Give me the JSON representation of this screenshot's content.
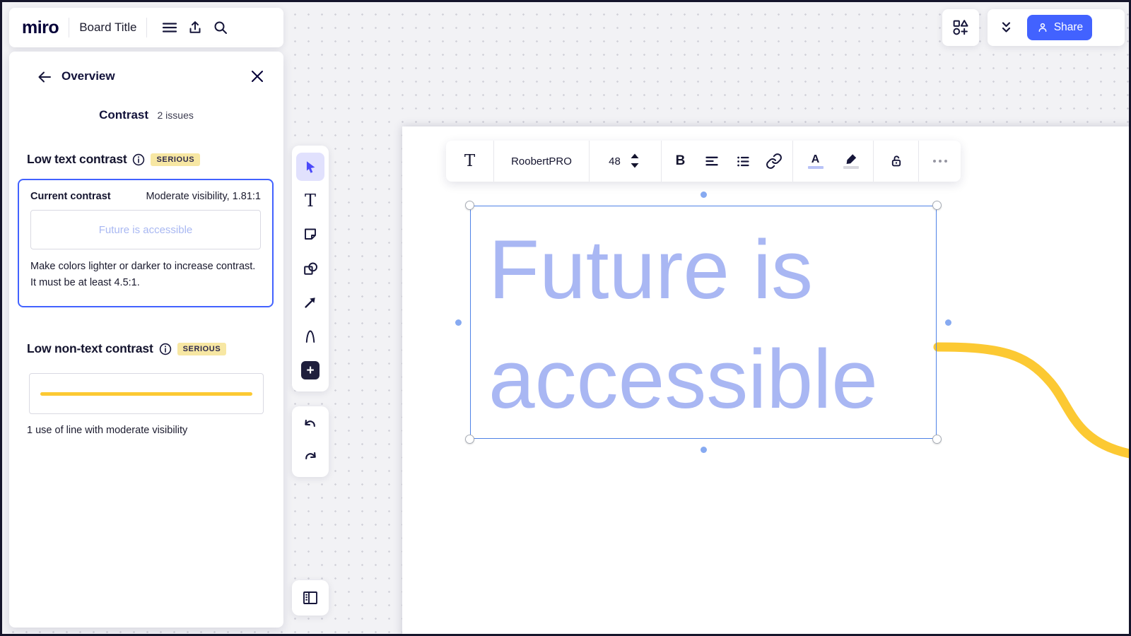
{
  "app": {
    "logo": "miro",
    "board_title": "Board Title"
  },
  "panel": {
    "title": "Overview",
    "contrast_heading": "Contrast",
    "issues_count": "2 issues",
    "low_text": {
      "heading": "Low text contrast",
      "severity": "SERIOUS",
      "current_contrast_label": "Current contrast",
      "visibility_value": "Moderate visibility, 1.81:1",
      "preview_text": "Future is accessible",
      "description": "Make colors lighter or darker to increase contrast. It must be at least 4.5:1."
    },
    "low_nontext": {
      "heading": "Low non-text contrast",
      "severity": "SERIOUS",
      "caption": "1 use of line with moderate visibility"
    }
  },
  "top_right": {
    "share_label": "Share"
  },
  "text_toolbar": {
    "font_name": "RoobertPRO",
    "font_size": "48"
  },
  "icons": {
    "text_glyph": "T",
    "bold_glyph": "B",
    "font_color_glyph": "A",
    "plus_glyph": "+"
  },
  "canvas": {
    "text_line1": "Future is",
    "text_line2": "accessible"
  },
  "colors": {
    "accent_blue": "#4262ff",
    "selection_blue": "#4e82e6",
    "canvas_text_lavender": "#a9b7f3",
    "warning_yellow": "#fcc933",
    "badge_yellow_bg": "#f7e7a3",
    "ink_navy": "#050038"
  }
}
